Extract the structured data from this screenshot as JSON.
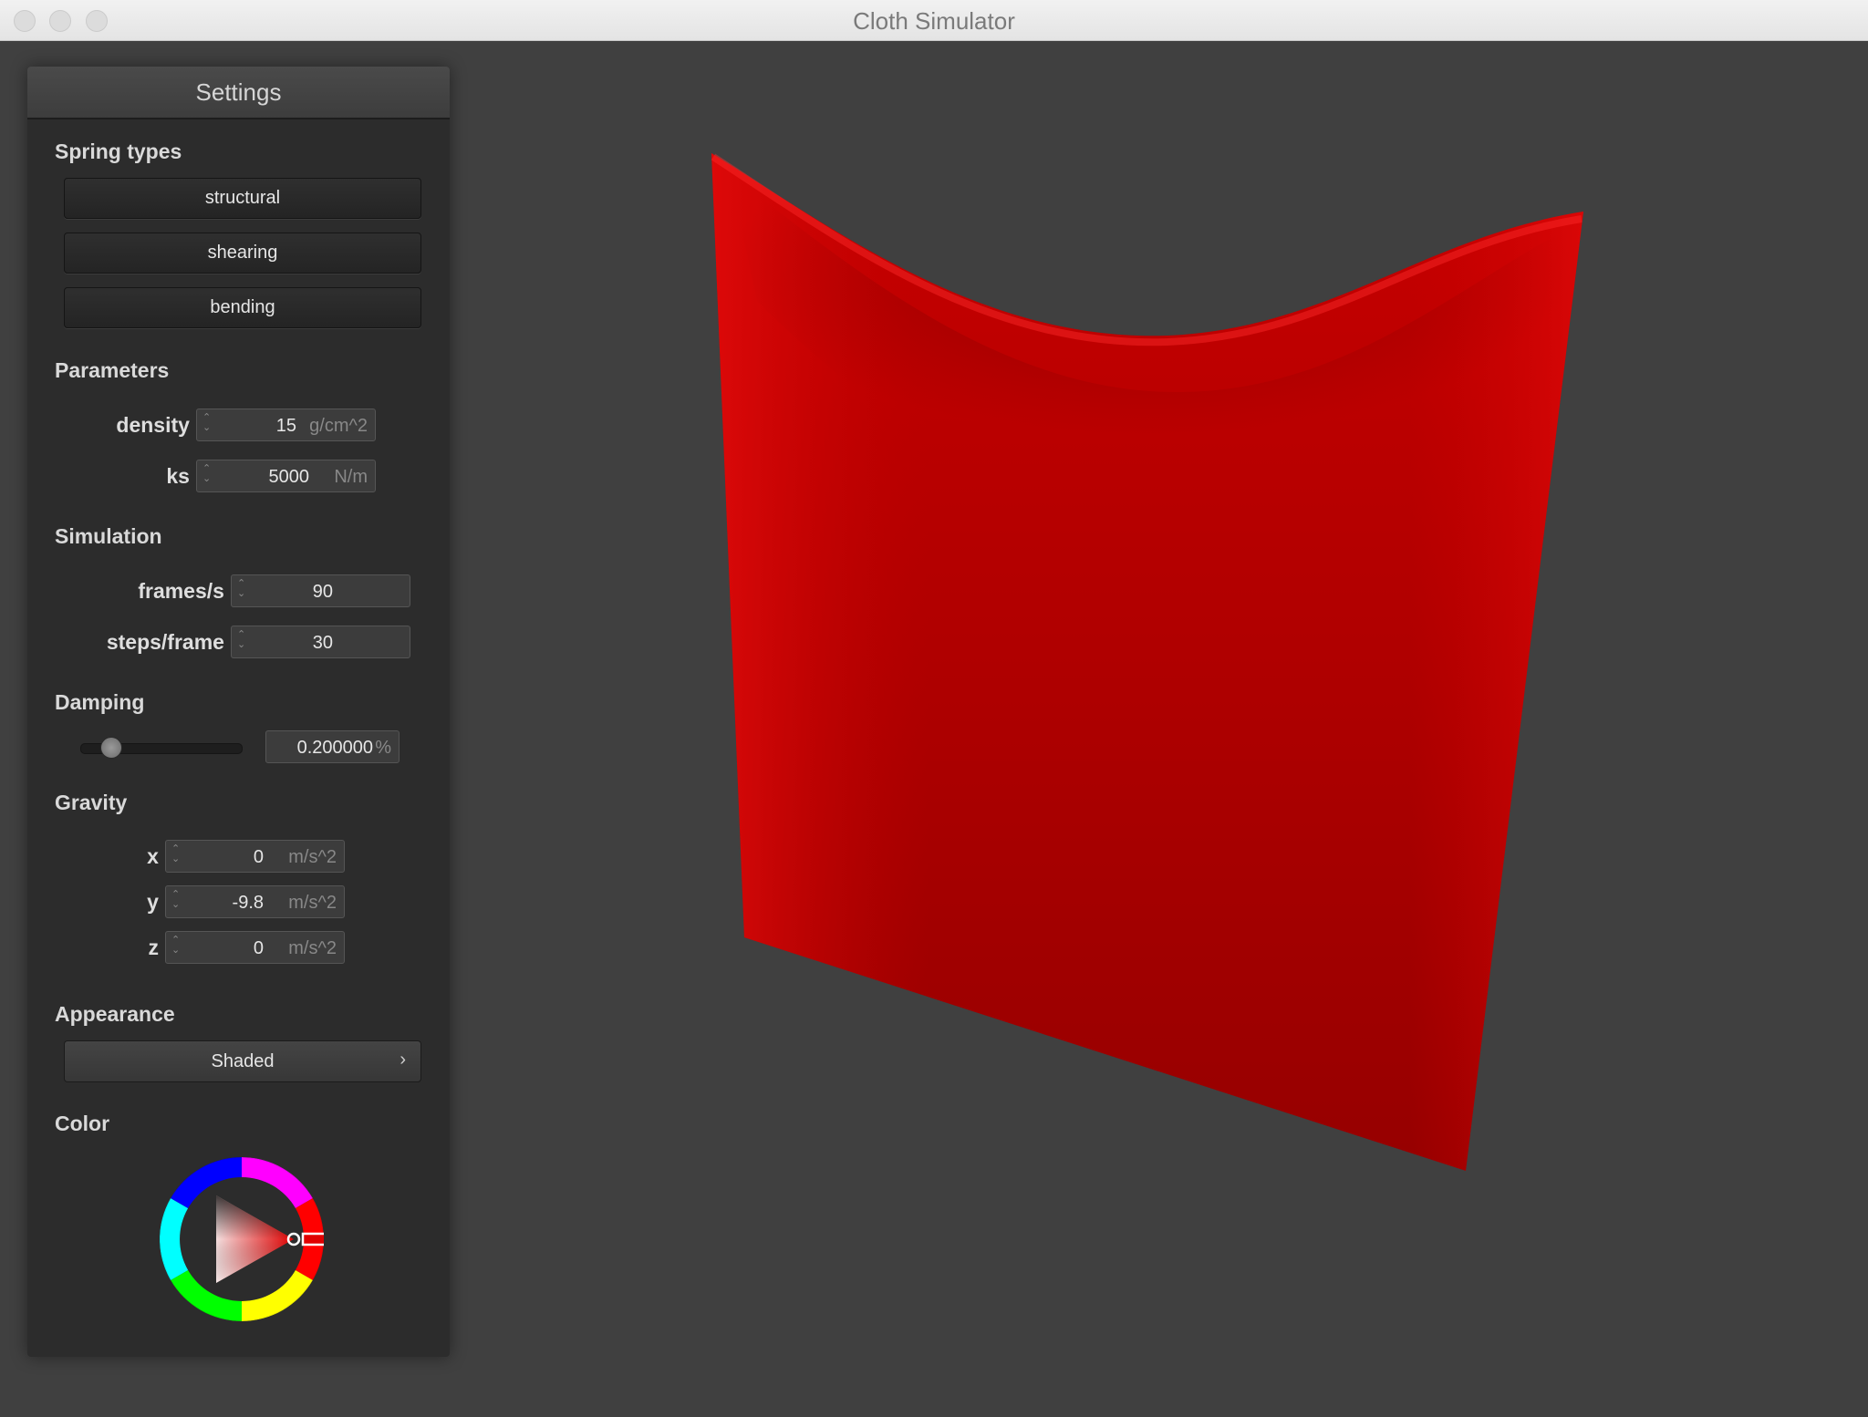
{
  "window": {
    "title": "Cloth Simulator"
  },
  "panel": {
    "title": "Settings",
    "spring_types": {
      "label": "Spring types",
      "buttons": [
        "structural",
        "shearing",
        "bending"
      ]
    },
    "parameters": {
      "label": "Parameters",
      "density": {
        "label": "density :",
        "value": "15",
        "unit": "g/cm^2"
      },
      "ks": {
        "label": "ks :",
        "value": "5000",
        "unit": "N/m"
      }
    },
    "simulation": {
      "label": "Simulation",
      "fps": {
        "label": "frames/s :",
        "value": "90"
      },
      "steps": {
        "label": "steps/frame :",
        "value": "30"
      }
    },
    "damping": {
      "label": "Damping",
      "value": "0.200000",
      "unit": "%",
      "slider_level": 0.2
    },
    "gravity": {
      "label": "Gravity",
      "x": {
        "label": "x :",
        "value": "0",
        "unit": "m/s^2"
      },
      "y": {
        "label": "y :",
        "value": "-9.8",
        "unit": "m/s^2"
      },
      "z": {
        "label": "z :",
        "value": "0",
        "unit": "m/s^2"
      }
    },
    "appearance": {
      "label": "Appearance",
      "selected": "Shaded"
    },
    "color": {
      "label": "Color",
      "selected": "#e00000"
    }
  },
  "colors": {
    "cloth": "#c80000",
    "background": "#404040"
  }
}
